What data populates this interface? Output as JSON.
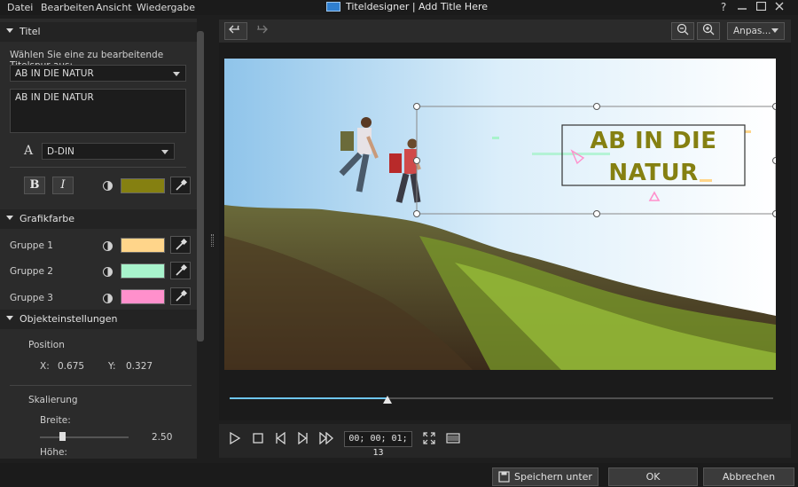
{
  "window": {
    "title": "Titeldesigner  |  Add Title Here",
    "menu": [
      "Datei",
      "Bearbeiten",
      "Ansicht",
      "Wiedergabe"
    ],
    "help_icon": "?",
    "minimize_icon": "minimize-icon",
    "maximize_icon": "maximize-icon",
    "close_icon": "close-icon"
  },
  "left_panel": {
    "titel_section": {
      "header": "Titel",
      "prompt": "Wählen Sie eine zu bearbeitende Titelspur aus:",
      "track_select": "AB IN DIE NATUR",
      "text_value": "AB IN DIE NATUR",
      "font_icon": "A",
      "font": "D-DIN",
      "bold_label": "B",
      "italic_label": "I",
      "text_color": "#858011"
    },
    "grafik_section": {
      "header": "Grafikfarbe",
      "groups": [
        {
          "label": "Gruppe 1",
          "color": "#ffd58a"
        },
        {
          "label": "Gruppe 2",
          "color": "#a8f3cc"
        },
        {
          "label": "Gruppe 3",
          "color": "#ff90cc"
        }
      ]
    },
    "objekt_section": {
      "header": "Objekteinstellungen",
      "position_label": "Position",
      "x_label": "X:",
      "x_value": "0.675",
      "y_label": "Y:",
      "y_value": "0.327",
      "scale_label": "Skalierung",
      "width_label": "Breite:",
      "width_value": "2.50",
      "width_slider_fraction": 0.25,
      "height_label": "Höhe:"
    }
  },
  "toolbar": {
    "undo_icon": "undo-icon",
    "redo_icon": "redo-icon",
    "zoom_out_icon": "zoom-out-icon",
    "zoom_in_icon": "zoom-in-icon",
    "fit_label": "Anpas..."
  },
  "preview": {
    "title_line1": "AB IN DIE",
    "title_line2": "NATUR",
    "title_color": "#858011"
  },
  "playback": {
    "progress_fraction": 0.29,
    "timecode": "00; 00; 01; 13"
  },
  "bottom": {
    "save_as": "Speichern unter",
    "ok": "OK",
    "cancel": "Abbrechen"
  }
}
